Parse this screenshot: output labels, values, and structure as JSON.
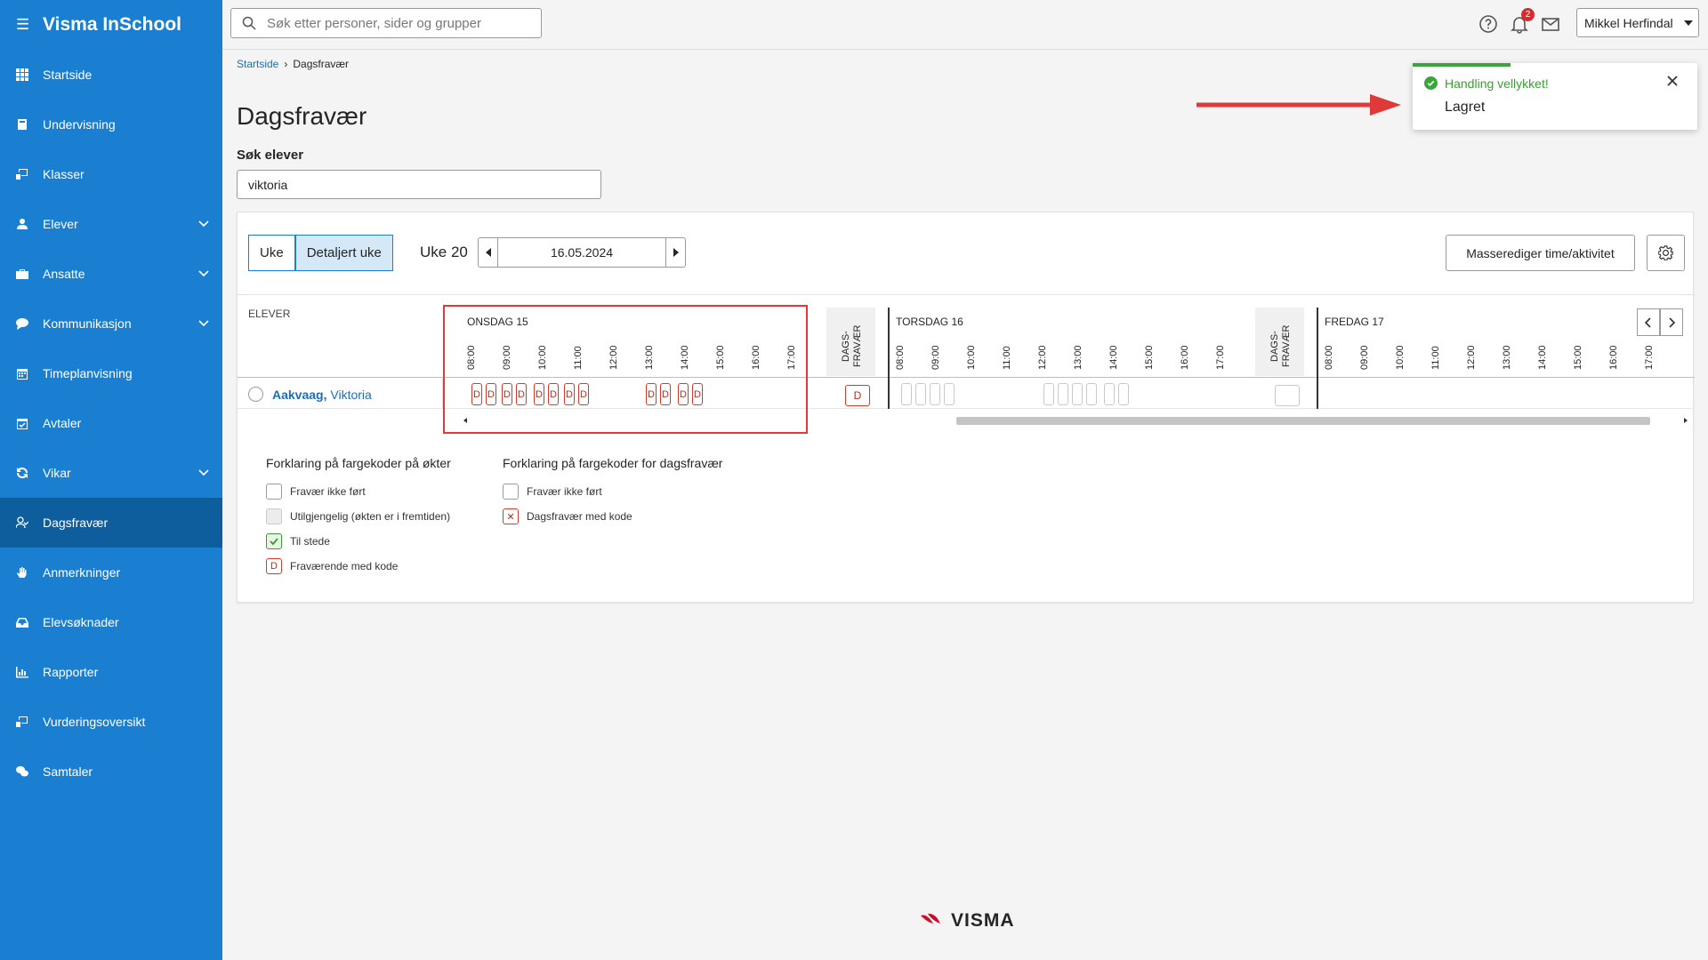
{
  "app": {
    "title": "Visma InSchool",
    "menu_icon": "hamburger-icon"
  },
  "sidebar": {
    "items": [
      {
        "label": "Startside",
        "icon": "grid-icon",
        "expandable": false
      },
      {
        "label": "Undervisning",
        "icon": "book-icon",
        "expandable": false
      },
      {
        "label": "Klasser",
        "icon": "board-icon",
        "expandable": false
      },
      {
        "label": "Elever",
        "icon": "student-icon",
        "expandable": true
      },
      {
        "label": "Ansatte",
        "icon": "briefcase-icon",
        "expandable": true
      },
      {
        "label": "Kommunikasjon",
        "icon": "chat-icon",
        "expandable": true
      },
      {
        "label": "Timeplanvisning",
        "icon": "calendar-icon",
        "expandable": false
      },
      {
        "label": "Avtaler",
        "icon": "calendar-check-icon",
        "expandable": false
      },
      {
        "label": "Vikar",
        "icon": "refresh-icon",
        "expandable": true
      },
      {
        "label": "Dagsfravær",
        "icon": "user-check-icon",
        "expandable": false,
        "active": true
      },
      {
        "label": "Anmerkninger",
        "icon": "hand-icon",
        "expandable": false
      },
      {
        "label": "Elevsøknader",
        "icon": "inbox-icon",
        "expandable": false
      },
      {
        "label": "Rapporter",
        "icon": "bar-chart-icon",
        "expandable": false
      },
      {
        "label": "Vurderingsoversikt",
        "icon": "board-icon",
        "expandable": false
      },
      {
        "label": "Samtaler",
        "icon": "chat-bubbles-icon",
        "expandable": false
      }
    ]
  },
  "topbar": {
    "search_placeholder": "Søk etter personer, sider og grupper",
    "notification_count": "2",
    "user_name": "Mikkel Herfindal"
  },
  "breadcrumb": {
    "home": "Startside",
    "current": "Dagsfravær"
  },
  "page": {
    "title": "Dagsfravær",
    "search_label": "Søk elever",
    "search_value": "viktoria"
  },
  "toolbar": {
    "view_week": "Uke",
    "view_detailed": "Detaljert uke",
    "week_label": "Uke 20",
    "date": "16.05.2024",
    "mass_edit": "Masserediger time/aktivitet"
  },
  "grid": {
    "elever_header": "ELEVER",
    "dags_header": "DAGS-\nFRAVÆR",
    "hours": [
      "08:00",
      "09:00",
      "10:00",
      "11:00",
      "12:00",
      "13:00",
      "14:00",
      "15:00",
      "16:00",
      "17:00"
    ],
    "days": [
      {
        "title": "ONSDAG 15",
        "dags_value": "D",
        "dags_status": "absent_with_code",
        "cells": [
          "D",
          "D",
          "D",
          "D",
          "D",
          "D",
          "D",
          "D",
          "D",
          "D",
          "D",
          "D",
          "D"
        ]
      },
      {
        "title": "TORSDAG 16",
        "dags_value": "",
        "dags_status": "not_registered",
        "cells": [
          "",
          "",
          "",
          "",
          "",
          "",
          "",
          "",
          "",
          "",
          ""
        ]
      },
      {
        "title": "FREDAG 17",
        "dags_value": null,
        "cells": []
      }
    ],
    "student": {
      "last_name": "Aakvaag,",
      "first_name": "Viktoria"
    }
  },
  "legend": {
    "sessions_title": "Forklaring på fargekoder på økter",
    "sessions": [
      {
        "label": "Fravær ikke ført",
        "style": "empty"
      },
      {
        "label": "Utilgjengelig (økten er i fremtiden)",
        "style": "grey"
      },
      {
        "label": "Til stede",
        "style": "green-check"
      },
      {
        "label": "Fraværende med kode",
        "style": "red-d",
        "symbol": "D"
      }
    ],
    "daily_title": "Forklaring på fargekoder for dagsfravær",
    "daily": [
      {
        "label": "Fravær ikke ført",
        "style": "empty"
      },
      {
        "label": "Dagsfravær med kode",
        "style": "red-x",
        "symbol": "✕"
      }
    ]
  },
  "toast": {
    "title": "Handling vellykket!",
    "message": "Lagret"
  },
  "footer": {
    "brand": "VISMA"
  },
  "colors": {
    "sidebar": "#1a7fd1",
    "sidebar_active": "#0e5d9c",
    "absent": "#d23a2a",
    "success": "#3aa53a",
    "annotation": "#e0393a"
  }
}
